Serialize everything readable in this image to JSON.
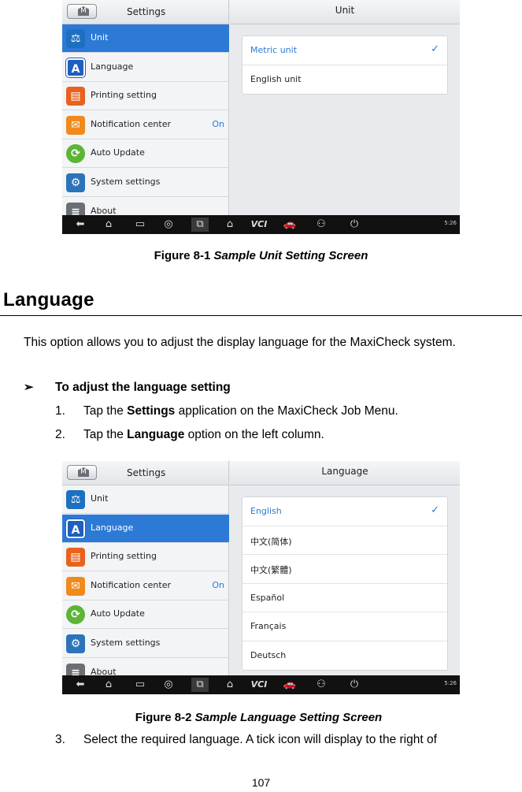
{
  "figure1": {
    "left_title": "Settings",
    "right_title": "Unit",
    "home_letter": "M",
    "menu": [
      {
        "label": "Unit",
        "icon": "unit-icon",
        "glyph": "⚖",
        "value": ""
      },
      {
        "label": "Language",
        "icon": "language-icon",
        "glyph": "A",
        "value": ""
      },
      {
        "label": "Printing setting",
        "icon": "printer-icon",
        "glyph": "▤",
        "value": ""
      },
      {
        "label": "Notification center",
        "icon": "envelope-icon",
        "glyph": "✉",
        "value": "On"
      },
      {
        "label": "Auto Update",
        "icon": "update-icon",
        "glyph": "⟳",
        "value": ""
      },
      {
        "label": "System settings",
        "icon": "gear-icon",
        "glyph": "⚙",
        "value": ""
      },
      {
        "label": "About",
        "icon": "about-icon",
        "glyph": "≡",
        "value": ""
      }
    ],
    "options": [
      {
        "label": "Metric unit",
        "checked": true
      },
      {
        "label": "English unit",
        "checked": false
      }
    ],
    "status_time": "5:26",
    "caption_prefix": "Figure 8-1",
    "caption_title": "Sample Unit Setting Screen"
  },
  "heading": "Language",
  "paragraph": "This option allows you to adjust the display language for the MaxiCheck system.",
  "bullet": "To adjust the language setting",
  "steps": [
    {
      "num": "1.",
      "pre": "Tap the ",
      "bold": "Settings",
      "post": " application on the MaxiCheck Job Menu."
    },
    {
      "num": "2.",
      "pre": "Tap the ",
      "bold": "Language",
      "post": " option on the left column."
    },
    {
      "num": "3.",
      "pre": "Select the required language. A tick icon will display to the right of",
      "bold": "",
      "post": ""
    }
  ],
  "figure2": {
    "left_title": "Settings",
    "right_title": "Language",
    "home_letter": "M",
    "menu": [
      {
        "label": "Unit",
        "icon": "unit-icon",
        "glyph": "⚖",
        "value": ""
      },
      {
        "label": "Language",
        "icon": "language-icon",
        "glyph": "A",
        "value": ""
      },
      {
        "label": "Printing setting",
        "icon": "printer-icon",
        "glyph": "▤",
        "value": ""
      },
      {
        "label": "Notification center",
        "icon": "envelope-icon",
        "glyph": "✉",
        "value": "On"
      },
      {
        "label": "Auto Update",
        "icon": "update-icon",
        "glyph": "⟳",
        "value": ""
      },
      {
        "label": "System settings",
        "icon": "gear-icon",
        "glyph": "⚙",
        "value": ""
      },
      {
        "label": "About",
        "icon": "about-icon",
        "glyph": "≡",
        "value": ""
      }
    ],
    "options": [
      {
        "label": "English",
        "checked": true
      },
      {
        "label": "中文(简体)",
        "checked": false
      },
      {
        "label": "中文(繁體)",
        "checked": false
      },
      {
        "label": "Español",
        "checked": false
      },
      {
        "label": "Français",
        "checked": false
      },
      {
        "label": "Deutsch",
        "checked": false
      }
    ],
    "status_time": "5:26",
    "caption_prefix": "Figure 8-2",
    "caption_title": "Sample Language Setting Screen"
  },
  "page_number": "107",
  "colors": {
    "accent": "#2c7ad6",
    "selected_row": "#2c7ad6"
  }
}
